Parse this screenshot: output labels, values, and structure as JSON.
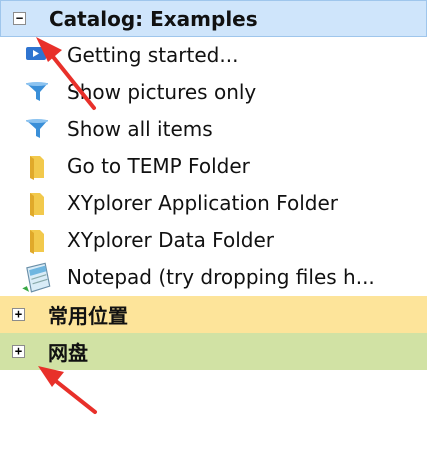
{
  "catalog": {
    "categories": [
      {
        "title": "Catalog: Examples",
        "toggle": "−",
        "items": [
          {
            "label": "Getting started...",
            "icon": "play-icon"
          },
          {
            "label": "Show pictures only",
            "icon": "filter-icon"
          },
          {
            "label": "Show all items",
            "icon": "filter-icon"
          },
          {
            "label": "Go to TEMP Folder",
            "icon": "folder-icon"
          },
          {
            "label": "XYplorer Application Folder",
            "icon": "folder-icon"
          },
          {
            "label": "XYplorer Data Folder",
            "icon": "folder-icon"
          },
          {
            "label": "Notepad (try dropping files h...",
            "icon": "notepad-icon"
          }
        ],
        "color": "#cfe5fb"
      },
      {
        "title": "常用位置",
        "toggle": "+",
        "color": "#fde49a"
      },
      {
        "title": "网盘",
        "toggle": "+",
        "color": "#d1e2a4"
      }
    ]
  },
  "annotations": {
    "arrow_color": "#e8302a"
  }
}
